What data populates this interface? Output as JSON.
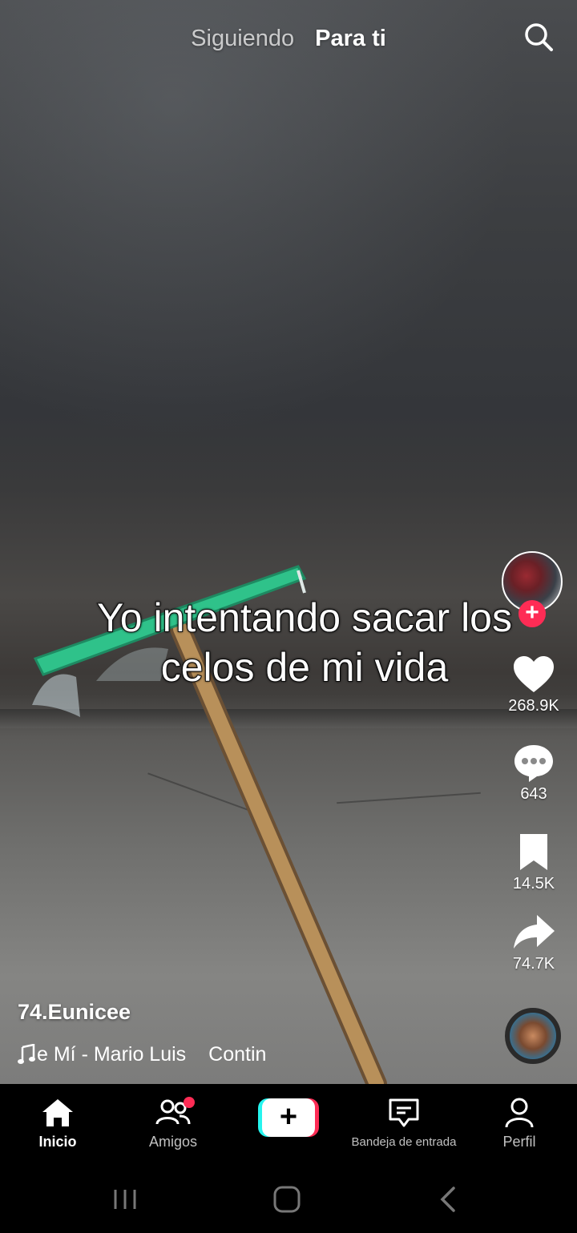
{
  "top_tabs": {
    "following": "Siguiendo",
    "for_you": "Para ti",
    "search_icon": "search-icon"
  },
  "video": {
    "caption_line1": "Yo intentando sacar los",
    "caption_line2": "celos de mi vida"
  },
  "actions": {
    "likes": "268.9K",
    "comments": "643",
    "saves": "14.5K",
    "shares": "74.7K",
    "follow_icon": "plus-icon"
  },
  "post": {
    "username": "74.Eunicee",
    "music_track": "e Mí - Mario Luis",
    "music_continue": "Contin"
  },
  "bottom_nav": {
    "home": "Inicio",
    "friends": "Amigos",
    "create": "+",
    "inbox": "Bandeja de entrada",
    "profile": "Perfil"
  },
  "colors": {
    "accent_red": "#fe2c55",
    "accent_cyan": "#25f4ee",
    "broom_green": "#2fc28a",
    "stick_tan": "#b8905a"
  }
}
